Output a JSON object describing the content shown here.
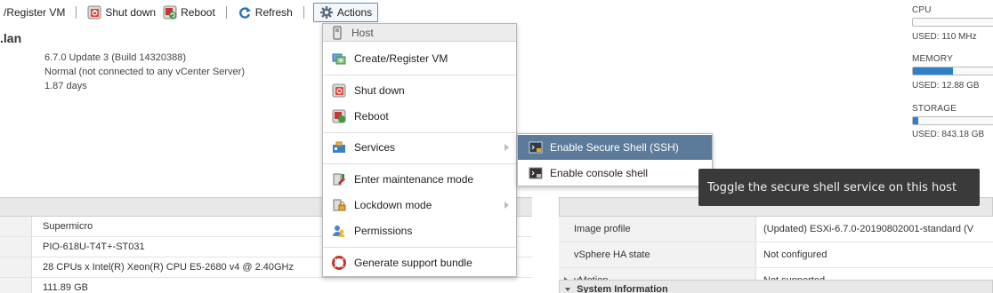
{
  "toolbar": {
    "create_register": "/Register VM",
    "shutdown": "Shut down",
    "reboot": "Reboot",
    "refresh": "Refresh",
    "actions": "Actions"
  },
  "host": {
    "name": ".lan",
    "version": "6.7.0 Update 3 (Build 14320388)",
    "state": "Normal (not connected to any vCenter Server)",
    "uptime": "1.87 days"
  },
  "meters": {
    "cpu": {
      "label": "CPU",
      "used": "USED: 110 MHz",
      "fill": 0
    },
    "memory": {
      "label": "MEMORY",
      "used": "USED: 12.88 GB",
      "fill": 0.48
    },
    "storage": {
      "label": "STORAGE",
      "used": "USED: 843.18 GB",
      "fill": 0.06
    }
  },
  "hardware_rows": [
    "Supermicro",
    "PIO-618U-T4T+-ST031",
    "28 CPUs x Intel(R) Xeon(R) CPU E5-2680 v4 @ 2.40GHz",
    "111.89 GB"
  ],
  "config_rows": [
    {
      "key": "Image profile",
      "value": "(Updated) ESXi-6.7.0-20190802001-standard (V"
    },
    {
      "key": "vSphere HA state",
      "value": "Not configured"
    },
    {
      "key": "vMotion",
      "value": "Not supported"
    }
  ],
  "system_info": "System Information",
  "actions_menu": {
    "header": "Host",
    "items": [
      {
        "label": "Create/Register VM",
        "icon": "create-vm-icon"
      },
      {
        "label": "Shut down",
        "icon": "shutdown-icon"
      },
      {
        "label": "Reboot",
        "icon": "reboot-icon"
      },
      {
        "label": "Services",
        "icon": "services-icon"
      },
      {
        "label": "Enter maintenance mode",
        "icon": "maintenance-icon"
      },
      {
        "label": "Lockdown mode",
        "icon": "lockdown-icon"
      },
      {
        "label": "Permissions",
        "icon": "permissions-icon"
      },
      {
        "label": "Generate support bundle",
        "icon": "support-bundle-icon"
      }
    ]
  },
  "services_submenu": [
    {
      "label": "Enable Secure Shell (SSH)",
      "icon": "ssh-icon",
      "active": true
    },
    {
      "label": "Enable console shell",
      "icon": "console-shell-icon",
      "active": false
    }
  ],
  "tooltip": "Toggle the secure shell service on this host"
}
